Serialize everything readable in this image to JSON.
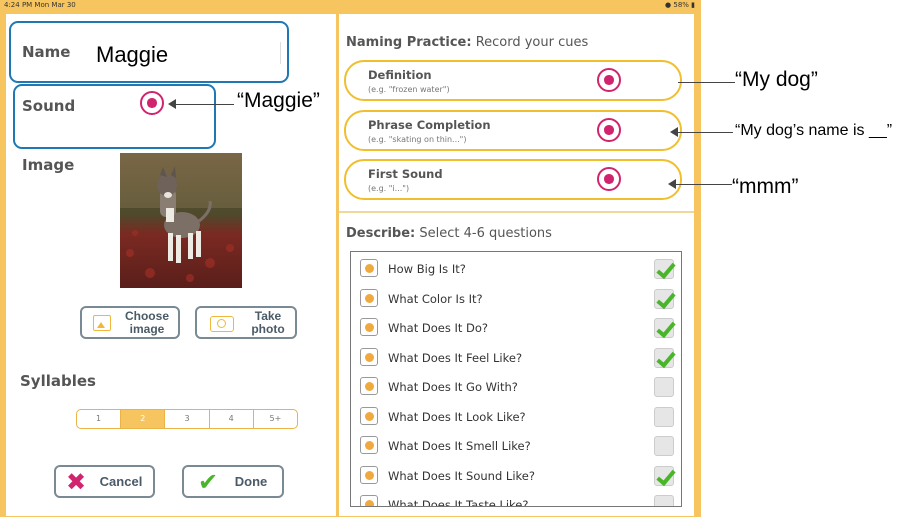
{
  "status_bar": {
    "time": "4:24 PM  Mon Mar 30",
    "battery": "58%"
  },
  "left": {
    "name_label": "Name",
    "name_value": "Maggie",
    "sound_label": "Sound",
    "image_label": "Image",
    "choose_image": [
      "Choose",
      "image"
    ],
    "take_photo": [
      "Take",
      "photo"
    ],
    "syllables_label": "Syllables",
    "syllable_options": [
      "1",
      "2",
      "3",
      "4",
      "5+"
    ],
    "syllable_selected": "2",
    "cancel_label": "Cancel",
    "done_label": "Done"
  },
  "naming": {
    "title_bold": "Naming Practice:",
    "title_rest": " Record your cues",
    "cues": [
      {
        "title": "Definition",
        "example": "(e.g. \"frozen water\")"
      },
      {
        "title": "Phrase Completion",
        "example": "(e.g. \"skating on thin...\")"
      },
      {
        "title": "First Sound",
        "example": "(e.g. \"i...\")"
      }
    ]
  },
  "describe": {
    "title_bold": "Describe:",
    "title_rest": " Select 4-6 questions",
    "questions": [
      {
        "label": "How Big Is It?",
        "checked": true
      },
      {
        "label": "What Color Is It?",
        "checked": true
      },
      {
        "label": "What Does It Do?",
        "checked": true
      },
      {
        "label": "What Does It Feel Like?",
        "checked": true
      },
      {
        "label": "What Does It Go With?",
        "checked": false
      },
      {
        "label": "What Does It Look Like?",
        "checked": false
      },
      {
        "label": "What Does It Smell Like?",
        "checked": false
      },
      {
        "label": "What Does It Sound Like?",
        "checked": true
      },
      {
        "label": "What Does It Taste Like?",
        "checked": false
      }
    ]
  },
  "annotations": {
    "sound": "“Maggie”",
    "definition": "“My dog”",
    "phrase": "“My dog’s name is __”",
    "first_sound": "“mmm”"
  },
  "colors": {
    "accent": "#f6c55f",
    "record": "#d0246f",
    "callout": "#1f78b4",
    "check": "#4ab52b",
    "cancel": "#d0246f"
  }
}
